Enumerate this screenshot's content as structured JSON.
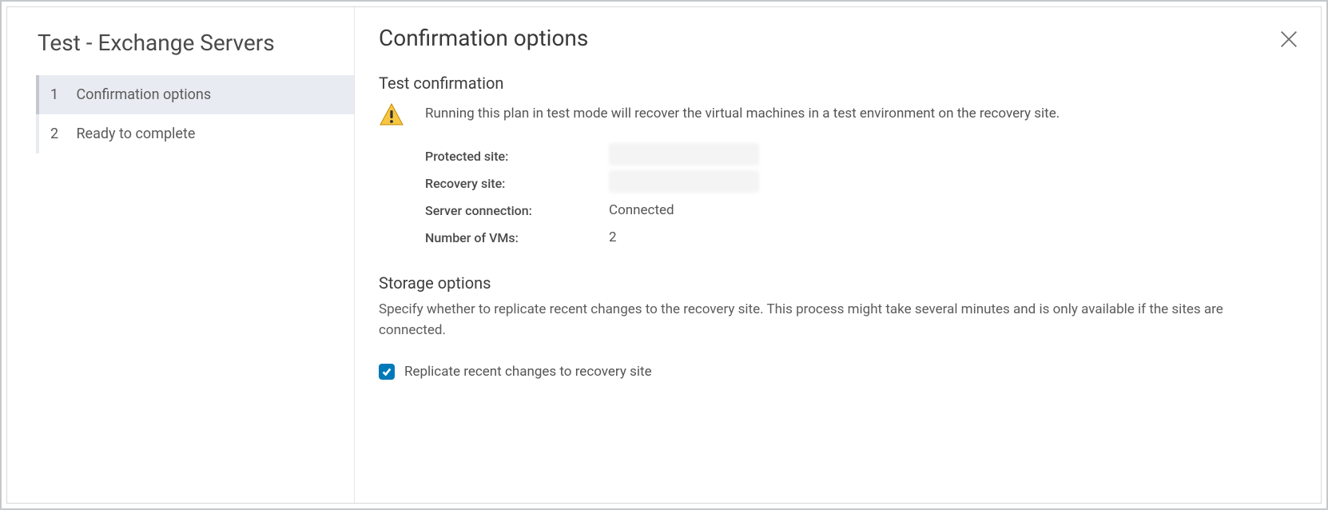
{
  "sidebar": {
    "title": "Test - Exchange Servers",
    "steps": [
      {
        "number": "1",
        "label": "Confirmation options",
        "active": true
      },
      {
        "number": "2",
        "label": "Ready to complete",
        "active": false
      }
    ]
  },
  "main": {
    "title": "Confirmation options",
    "test_confirmation": {
      "heading": "Test confirmation",
      "warning_text": "Running this plan in test mode will recover the virtual machines in a test environment on the recovery site.",
      "details": {
        "protected_site_label": "Protected site:",
        "protected_site_value": "",
        "recovery_site_label": "Recovery site:",
        "recovery_site_value": "",
        "server_connection_label": "Server connection:",
        "server_connection_value": "Connected",
        "number_of_vms_label": "Number of VMs:",
        "number_of_vms_value": "2"
      }
    },
    "storage_options": {
      "heading": "Storage options",
      "description": "Specify whether to replicate recent changes to the recovery site. This process might take several minutes and is only available if the sites are connected.",
      "checkbox_label": "Replicate recent changes to recovery site",
      "checkbox_checked": true
    }
  }
}
